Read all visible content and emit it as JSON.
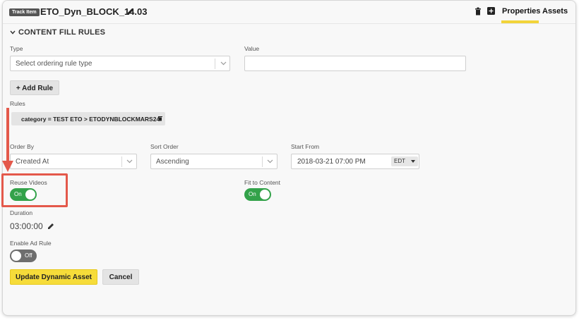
{
  "header": {
    "badge": "Track Item",
    "title": "ETO_Dyn_BLOCK_14.03",
    "tabs": [
      "Properties",
      "Assets"
    ],
    "active_tab": "Properties"
  },
  "section": {
    "title": "CONTENT FILL RULES"
  },
  "type_field": {
    "label": "Type",
    "placeholder": "Select ordering rule type"
  },
  "value_field": {
    "label": "Value",
    "value": ""
  },
  "add_rule_button": "+ Add Rule",
  "rules": {
    "label": "Rules",
    "items": [
      "category = TEST ETO > ETODYNBLOCKMARS24"
    ]
  },
  "order_by": {
    "label": "Order By",
    "value": "Created At"
  },
  "sort_order": {
    "label": "Sort Order",
    "value": "Ascending"
  },
  "start_from": {
    "label": "Start From",
    "value": "2018-03-21 07:00 PM",
    "timezone": "EDT"
  },
  "reuse_videos": {
    "label": "Reuse Videos",
    "state": "On"
  },
  "fit_to_content": {
    "label": "Fit to Content",
    "state": "On"
  },
  "duration": {
    "label": "Duration",
    "value": "03:00:00"
  },
  "enable_ad_rule": {
    "label": "Enable Ad Rule",
    "state": "Off"
  },
  "actions": {
    "update": "Update Dynamic Asset",
    "cancel": "Cancel"
  },
  "colors": {
    "toggle_on": "#33a24a",
    "toggle_off": "#6e6e6e",
    "accent": "#f2d43a",
    "annotation": "#e4594b"
  }
}
